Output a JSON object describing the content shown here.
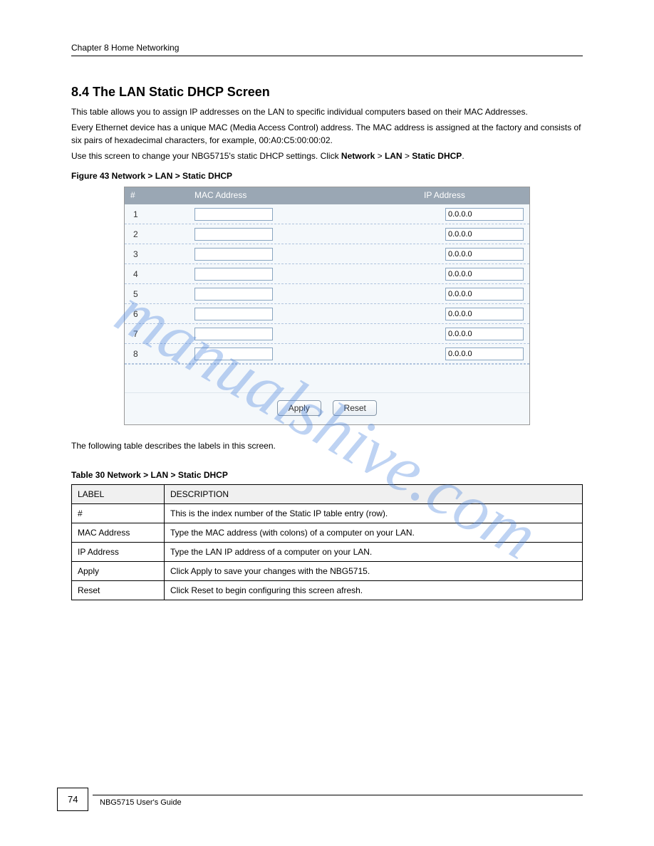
{
  "watermark": "manualshive.com",
  "chapter_label": "Chapter 8 Home Networking",
  "section_heading": "8.4  The LAN Static DHCP Screen",
  "intro_text": "This table allows you to assign IP addresses on the LAN to specific individual computers based on their MAC Addresses.",
  "intro_text2": "Every Ethernet device has a unique MAC (Media Access Control) address. The MAC address is assigned at the factory and consists of six pairs of hexadecimal characters, for example, 00:A0:C5:00:00:02.",
  "intro_text3": "Use this screen to change your NBG5715's static DHCP settings. Click ",
  "click_path_strong1": "Network",
  "click_sep1": " > ",
  "click_path_strong2": "LAN",
  "click_sep2": " > ",
  "click_path_strong3": "Static DHCP",
  "figure_caption": "Figure 43   Network > LAN > Static DHCP",
  "panel_headers": {
    "idx": "#",
    "mac": "MAC Address",
    "ip": "IP Address"
  },
  "rows": [
    {
      "idx": "1",
      "mac": "",
      "ip": "0.0.0.0"
    },
    {
      "idx": "2",
      "mac": "",
      "ip": "0.0.0.0"
    },
    {
      "idx": "3",
      "mac": "",
      "ip": "0.0.0.0"
    },
    {
      "idx": "4",
      "mac": "",
      "ip": "0.0.0.0"
    },
    {
      "idx": "5",
      "mac": "",
      "ip": "0.0.0.0"
    },
    {
      "idx": "6",
      "mac": "",
      "ip": "0.0.0.0"
    },
    {
      "idx": "7",
      "mac": "",
      "ip": "0.0.0.0"
    },
    {
      "idx": "8",
      "mac": "",
      "ip": "0.0.0.0"
    }
  ],
  "buttons": {
    "apply": "Apply",
    "reset": "Reset"
  },
  "desc_intro": "The following table describes the labels in this screen.",
  "desc_caption": "Table 30   Network > LAN > Static DHCP",
  "desc_header": {
    "label": "LABEL",
    "description": "DESCRIPTION"
  },
  "desc_rows": [
    {
      "label": "#",
      "desc": "This is the index number of the Static IP table entry (row)."
    },
    {
      "label": "MAC Address",
      "desc": "Type the MAC address (with colons) of a computer on your LAN."
    },
    {
      "label": "IP Address",
      "desc": "Type the LAN IP address of a computer on your LAN."
    },
    {
      "label": "Apply",
      "desc": "Click Apply to save your changes with the NBG5715."
    },
    {
      "label": "Reset",
      "desc": "Click Reset to begin configuring this screen afresh."
    }
  ],
  "page_number": "74",
  "footer_text": "NBG5715 User's Guide"
}
